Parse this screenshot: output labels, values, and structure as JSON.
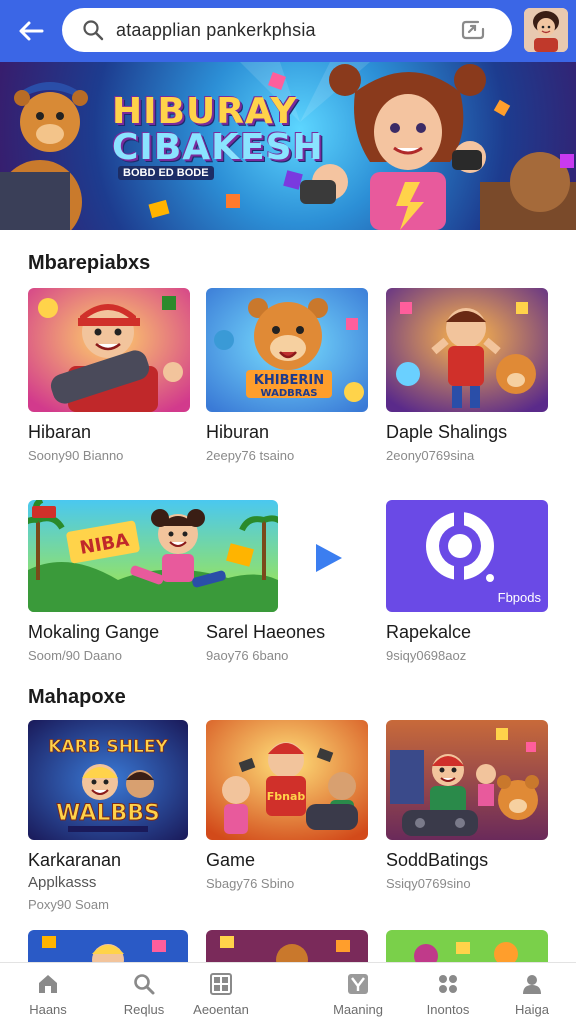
{
  "search": {
    "query": "ataapplian pankerkphsia"
  },
  "banner": {
    "title_line1": "HIBURAY",
    "title_line2": "CIBAKESH",
    "subtitle": "BOBD ED BODE"
  },
  "sections": [
    {
      "title": "Mbarepiabxs",
      "cards": [
        {
          "title": "Hibaran",
          "meta": "Soony90 Bianno"
        },
        {
          "title": "Hiburan",
          "meta": "2eepy76 tsaino"
        },
        {
          "title": "Daple Shalings",
          "meta": "2eony0769sina"
        },
        {
          "title": "Mokaling Gange",
          "meta": "Soom/90 Daano"
        },
        {
          "title": "Sarel Haeones",
          "meta": "9aoy76 6bano"
        },
        {
          "title": "Rapekalce",
          "meta": "9siqy0698aoz"
        }
      ],
      "tile_texts": [
        "KHIBERIN",
        "WADBRAS",
        "NIBA",
        "Fbpods"
      ]
    },
    {
      "title": "Mahapoxe",
      "cards": [
        {
          "title": "Karkaranan",
          "meta": "Poxy90 Soam",
          "sub": "Applkasss"
        },
        {
          "title": "Game",
          "meta": "Sbagy76 Sbino"
        },
        {
          "title": "SoddBatings",
          "meta": "Ssiqy0769sino"
        }
      ],
      "tile_texts": [
        "KARB SHLEY",
        "WALBBS",
        "Fbnab"
      ]
    }
  ],
  "nav": [
    {
      "label": "Haans",
      "icon": "home-icon"
    },
    {
      "label": "Reqlus",
      "icon": "search-icon"
    },
    {
      "label": "Aeoentan",
      "icon": "grid-icon"
    },
    {
      "label": "Maaning",
      "icon": "game-icon"
    },
    {
      "label": "Inontos",
      "icon": "apps-icon"
    },
    {
      "label": "Haiga",
      "icon": "profile-icon"
    }
  ]
}
